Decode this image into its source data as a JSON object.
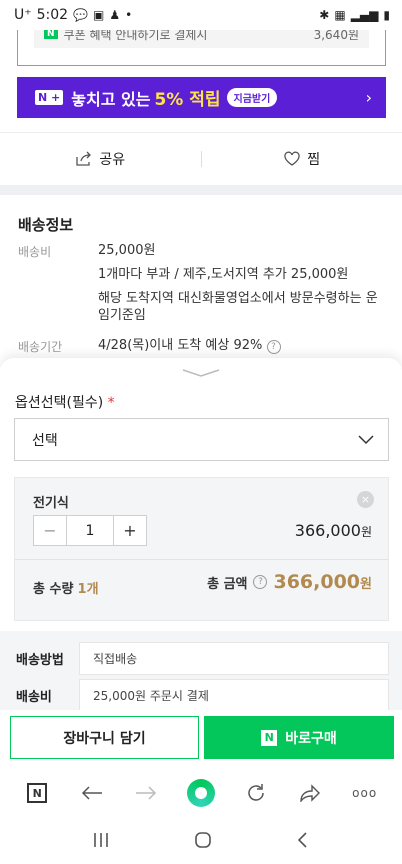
{
  "status_bar": {
    "carrier": "U⁺",
    "time": "5:02",
    "icons_left": [
      "chat-icon",
      "gallery-icon",
      "person-icon",
      "dot"
    ],
    "icons_right": [
      "bluetooth-icon",
      "5g-icon",
      "signal-icon",
      "battery-icon"
    ]
  },
  "top_partial": {
    "text": "쿠폰 혜택 안내하기로 결제시",
    "amount": "3,640원"
  },
  "promo_banner": {
    "badge": "N +",
    "text": "놓치고 있는 ",
    "highlight": "5% 적립",
    "pill": "지금받기",
    "arrow": "›"
  },
  "share_bar": {
    "share_label": "공유",
    "wish_label": "찜"
  },
  "shipping_info": {
    "title": "배송정보",
    "fee_label": "배송비",
    "fee_value": "25,000원",
    "fee_extra": "1개마다 부과 / 제주,도서지역 추가 25,000원",
    "fee_note_line1": "해당 도착지역 대신화물영업소에서 방문수령하는 운",
    "fee_note_line2": "임기준임",
    "period_label": "배송기간",
    "period_value": "4/28(목)이내 도착 예상 92%"
  },
  "option_sheet": {
    "title": "옵션선택(필수)",
    "required_mark": "*",
    "select_value": "선택",
    "item": {
      "name": "전기식",
      "quantity": "1",
      "minus": "−",
      "plus": "+",
      "price": "366,000",
      "currency": "원"
    },
    "total_qty_label": "총 수량",
    "total_qty_value": "1개",
    "total_amount_label": "총 금액",
    "total_amount": "366,000",
    "total_currency": "원",
    "delivery_method_label": "배송방법",
    "delivery_method_value": "직접배송",
    "delivery_fee_label": "배송비",
    "delivery_fee_value": "25,000원 주문시 결제"
  },
  "actions": {
    "cart_label": "장바구니 담기",
    "buy_logo": "N",
    "buy_label": "바로구매"
  },
  "browser_toolbar": {
    "n_logo": "N",
    "more": "ooo"
  },
  "colors": {
    "naver_green": "#03c75a",
    "promo_purple": "#5b1fd6",
    "price_gold": "#b28a4f",
    "required_red": "#e8333c"
  }
}
